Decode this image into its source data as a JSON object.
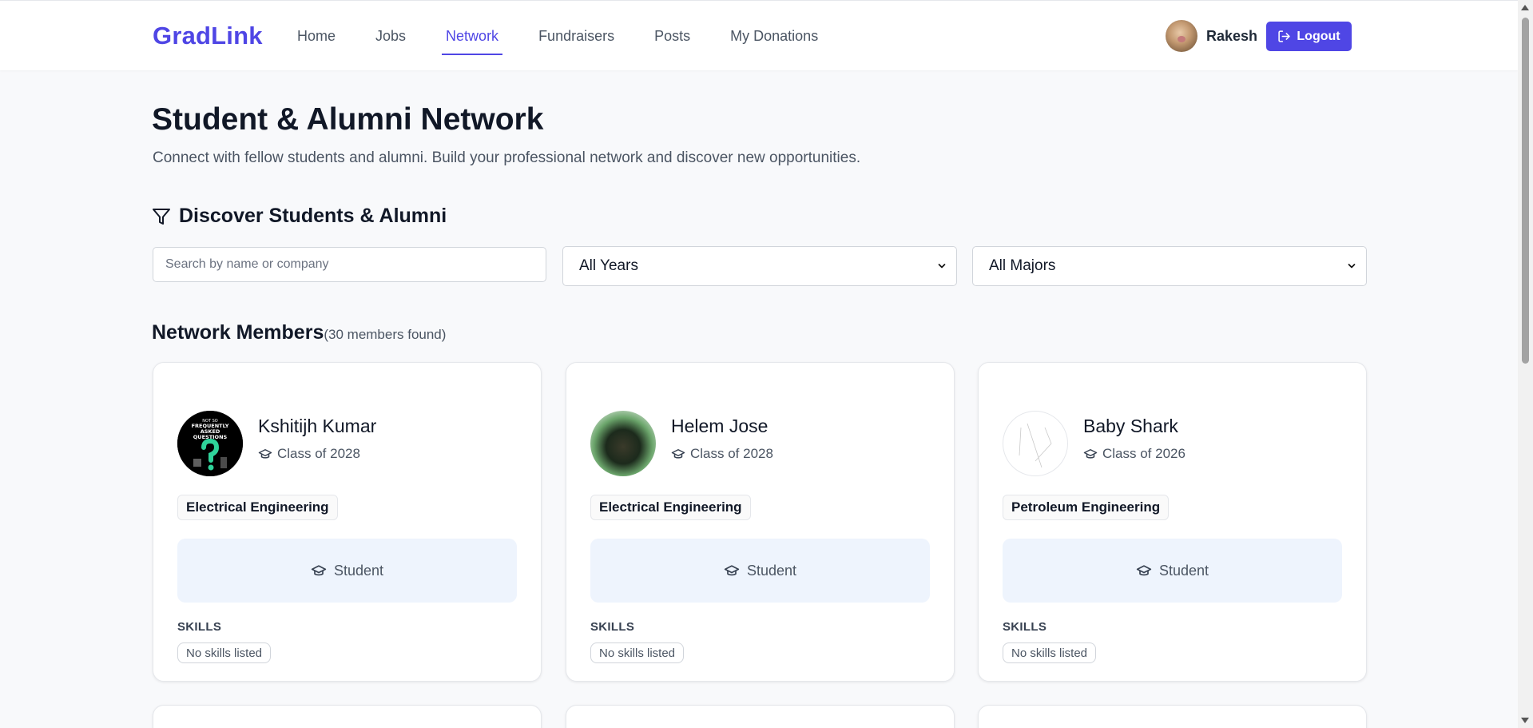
{
  "app": {
    "logo": "GradLink"
  },
  "nav": {
    "items": [
      {
        "label": "Home",
        "active": false
      },
      {
        "label": "Jobs",
        "active": false
      },
      {
        "label": "Network",
        "active": true
      },
      {
        "label": "Fundraisers",
        "active": false
      },
      {
        "label": "Posts",
        "active": false
      },
      {
        "label": "My Donations",
        "active": false
      }
    ]
  },
  "user": {
    "name": "Rakesh",
    "logout_label": "Logout"
  },
  "page": {
    "title": "Student & Alumni Network",
    "subtitle": "Connect with fellow students and alumni. Build your professional network and discover new opportunities."
  },
  "filters": {
    "heading": "Discover Students & Alumni",
    "search_placeholder": "Search by name or company",
    "search_value": "",
    "year_selected": "All Years",
    "major_selected": "All Majors"
  },
  "members": {
    "heading": "Network Members",
    "count_text": "(30 members found)",
    "cards": [
      {
        "name": "Kshitijh Kumar",
        "class": "Class of 2028",
        "major": "Electrical Engineering",
        "role": "Student",
        "skills_label": "SKILLS",
        "skills": "No skills listed",
        "avatar_lines": [
          "NOT SO",
          "FREQUENTLY",
          "ASKED",
          "QUESTIONS"
        ]
      },
      {
        "name": "Helem Jose",
        "class": "Class of 2028",
        "major": "Electrical Engineering",
        "role": "Student",
        "skills_label": "SKILLS",
        "skills": "No skills listed"
      },
      {
        "name": "Baby Shark",
        "class": "Class of 2026",
        "major": "Petroleum Engineering",
        "role": "Student",
        "skills_label": "SKILLS",
        "skills": "No skills listed"
      }
    ]
  },
  "colors": {
    "accent": "#4f46e5",
    "role_bg": "#eef4fd"
  }
}
